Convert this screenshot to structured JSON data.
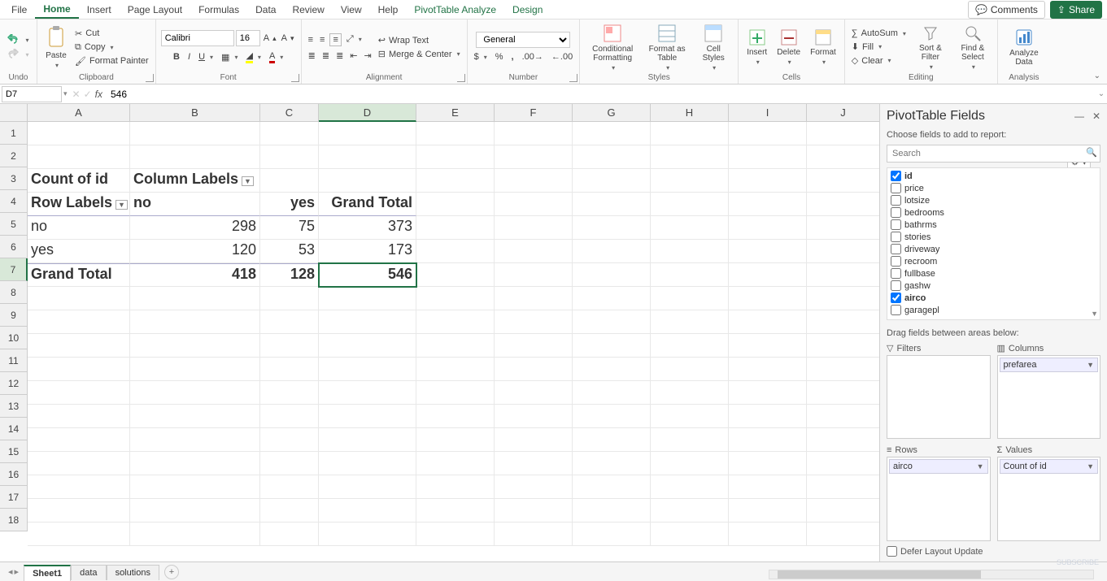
{
  "menu": {
    "tabs": [
      "File",
      "Home",
      "Insert",
      "Page Layout",
      "Formulas",
      "Data",
      "Review",
      "View",
      "Help",
      "PivotTable Analyze",
      "Design"
    ],
    "active": "Home",
    "comments": "Comments",
    "share": "Share"
  },
  "ribbon": {
    "undo_label": "Undo",
    "clipboard": {
      "paste": "Paste",
      "cut": "Cut",
      "copy": "Copy",
      "format_painter": "Format Painter",
      "label": "Clipboard"
    },
    "font": {
      "name": "Calibri",
      "size": "16",
      "label": "Font"
    },
    "alignment": {
      "wrap": "Wrap Text",
      "merge": "Merge & Center",
      "label": "Alignment"
    },
    "number": {
      "format": "General",
      "label": "Number"
    },
    "styles": {
      "cond": "Conditional Formatting",
      "table": "Format as Table",
      "cell": "Cell Styles",
      "label": "Styles"
    },
    "cells": {
      "insert": "Insert",
      "delete": "Delete",
      "format": "Format",
      "label": "Cells"
    },
    "editing": {
      "autosum": "AutoSum",
      "fill": "Fill",
      "clear": "Clear",
      "sort": "Sort & Filter",
      "find": "Find & Select",
      "label": "Editing"
    },
    "analysis": {
      "analyze": "Analyze Data",
      "label": "Analysis"
    }
  },
  "formula_bar": {
    "cell_ref": "D7",
    "value": "546"
  },
  "columns": [
    "A",
    "B",
    "C",
    "D",
    "E",
    "F",
    "G",
    "H",
    "I",
    "J"
  ],
  "row_numbers": [
    1,
    2,
    3,
    4,
    5,
    6,
    7,
    8,
    9,
    10,
    11,
    12,
    13,
    14,
    15,
    16,
    17,
    18
  ],
  "pivot_data": {
    "A3": "Count of id",
    "B3": "Column Labels",
    "A4": "Row Labels",
    "B4": "no",
    "C4": "yes",
    "D4": "Grand Total",
    "A5": "no",
    "B5": "298",
    "C5": "75",
    "D5": "373",
    "A6": "yes",
    "B6": "120",
    "C6": "53",
    "D6": "173",
    "A7": "Grand Total",
    "B7": "418",
    "C7": "128",
    "D7": "546"
  },
  "pivot_pane": {
    "title": "PivotTable Fields",
    "subtitle": "Choose fields to add to report:",
    "search_placeholder": "Search",
    "fields": [
      {
        "name": "id",
        "checked": true
      },
      {
        "name": "price",
        "checked": false
      },
      {
        "name": "lotsize",
        "checked": false
      },
      {
        "name": "bedrooms",
        "checked": false
      },
      {
        "name": "bathrms",
        "checked": false
      },
      {
        "name": "stories",
        "checked": false
      },
      {
        "name": "driveway",
        "checked": false
      },
      {
        "name": "recroom",
        "checked": false
      },
      {
        "name": "fullbase",
        "checked": false
      },
      {
        "name": "gashw",
        "checked": false
      },
      {
        "name": "airco",
        "checked": true
      },
      {
        "name": "garagepl",
        "checked": false
      }
    ],
    "drag_label": "Drag fields between areas below:",
    "filters_label": "Filters",
    "columns_label": "Columns",
    "rows_label": "Rows",
    "values_label": "Values",
    "columns_item": "prefarea",
    "rows_item": "airco",
    "values_item": "Count of id",
    "defer": "Defer Layout Update"
  },
  "sheet_tabs": {
    "tabs": [
      "Sheet1",
      "data",
      "solutions"
    ],
    "active": "Sheet1"
  }
}
